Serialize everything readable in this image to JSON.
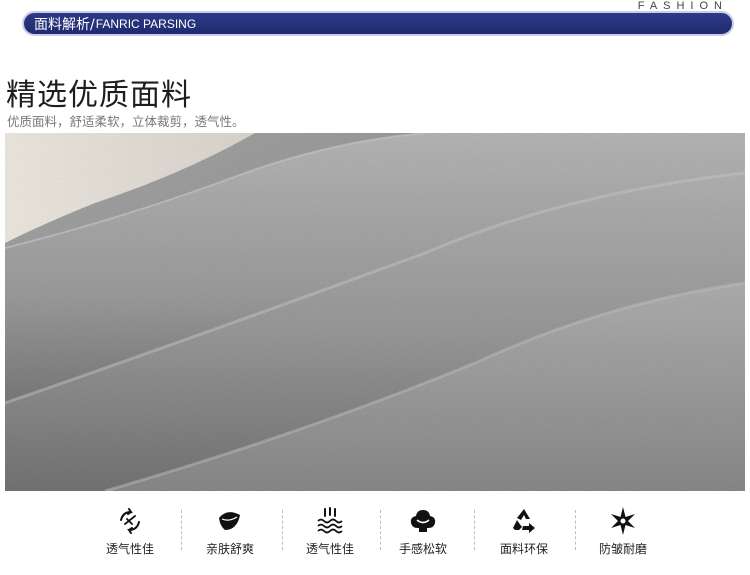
{
  "header": {
    "fashion_word": "FASHION",
    "banner_cn": "面料解析/",
    "banner_en": "FANRIC PARSING"
  },
  "section": {
    "title": "精选优质面料",
    "subtitle": "优质面料，舒适柔软，立体裁剪，透气性。"
  },
  "features": [
    {
      "icon": "breathable-arrows-icon",
      "label": "透气性佳"
    },
    {
      "icon": "leaf-icon",
      "label": "亲肤舒爽"
    },
    {
      "icon": "steam-waves-icon",
      "label": "透气性佳"
    },
    {
      "icon": "soft-hand-icon",
      "label": "手感松软"
    },
    {
      "icon": "recycle-icon",
      "label": "面料环保"
    },
    {
      "icon": "star-burst-icon",
      "label": "防皱耐磨"
    }
  ],
  "colors": {
    "banner": "#1f2a6e",
    "fabric": "#9a9a9a"
  }
}
